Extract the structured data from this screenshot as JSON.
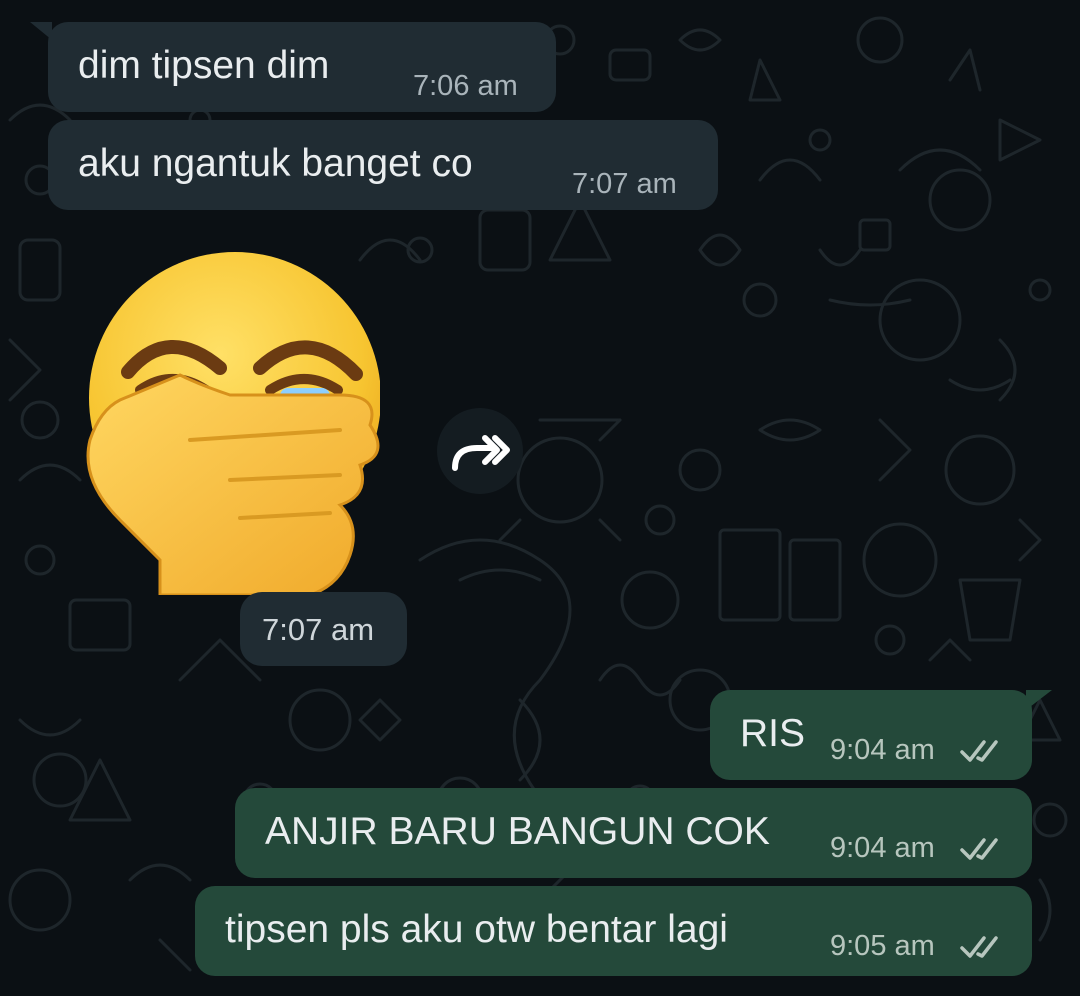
{
  "chat": {
    "incoming": [
      {
        "text": "dim tipsen dim",
        "time": "7:06 am"
      },
      {
        "text": "aku ngantuk banget co",
        "time": "7:07 am"
      }
    ],
    "sticker": {
      "icon": "crying-face-emoji-icon",
      "time": "7:07 am"
    },
    "forward": {
      "icon": "forward-arrow-icon"
    },
    "outgoing": [
      {
        "text": "RIS",
        "time": "9:04 am",
        "status_icon": "double-check-icon"
      },
      {
        "text": "ANJIR BARU BANGUN COK",
        "time": "9:04 am",
        "status_icon": "double-check-icon"
      },
      {
        "text": "tipsen pls aku otw bentar lagi",
        "time": "9:05 am",
        "status_icon": "double-check-icon"
      }
    ]
  },
  "colors": {
    "background": "#0b1014",
    "incoming_bubble": "#202c33",
    "outgoing_bubble": "#24493a",
    "text": "#e9edef",
    "meta": "#a9b4ba"
  }
}
